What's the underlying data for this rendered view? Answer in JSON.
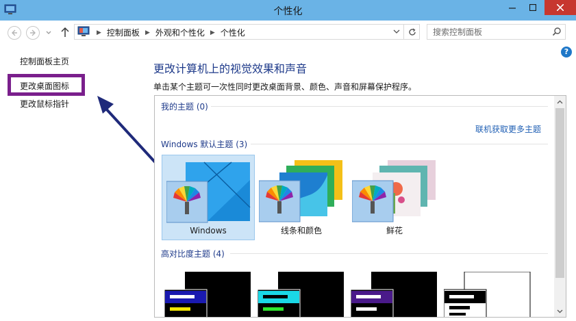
{
  "window": {
    "title": "个性化"
  },
  "address": {
    "crumbs": [
      "控制面板",
      "外观和个性化",
      "个性化"
    ]
  },
  "search": {
    "placeholder": "搜索控制面板"
  },
  "sidebar": {
    "items": [
      {
        "label": "控制面板主页"
      },
      {
        "label": "更改桌面图标"
      },
      {
        "label": "更改鼠标指针"
      }
    ]
  },
  "main": {
    "heading": "更改计算机上的视觉效果和声音",
    "subtitle": "单击某个主题可一次性同时更改桌面背景、颜色、声音和屏幕保护程序。",
    "my_themes": "我的主题 (0)",
    "online_link": "联机获取更多主题",
    "default_themes": "Windows 默认主题 (3)",
    "themes": [
      {
        "name": "Windows"
      },
      {
        "name": "线条和颜色"
      },
      {
        "name": "鲜花"
      }
    ],
    "high_contrast": "高对比度主题 (4)"
  },
  "colors": {
    "titlebar": "#6ab3e6",
    "heading": "#1e3a8a",
    "link": "#1f5fb4",
    "highlight_box": "#7a1f8c",
    "arrow": "#1f2a7a",
    "selection": "#cce4f7"
  }
}
